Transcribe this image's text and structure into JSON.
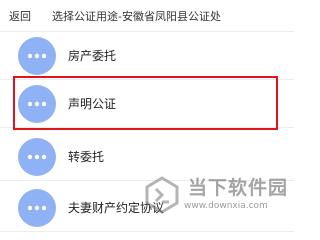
{
  "header": {
    "back_label": "返回",
    "title": "选择公证用途-安徽省凤阳县公证处"
  },
  "list": {
    "items": [
      {
        "label": "房产委托",
        "icon": "more-dots-icon"
      },
      {
        "label": "声明公证",
        "icon": "more-dots-icon",
        "highlighted": true
      },
      {
        "label": "转委托",
        "icon": "more-dots-icon"
      },
      {
        "label": "夫妻财产约定协议",
        "icon": "more-dots-icon"
      }
    ]
  },
  "watermark": {
    "text": "当下软件园",
    "url": "www.downxia.com"
  },
  "colors": {
    "avatar": "#8fb2f5",
    "highlight": "#e0151c",
    "background": "#ffffff"
  }
}
